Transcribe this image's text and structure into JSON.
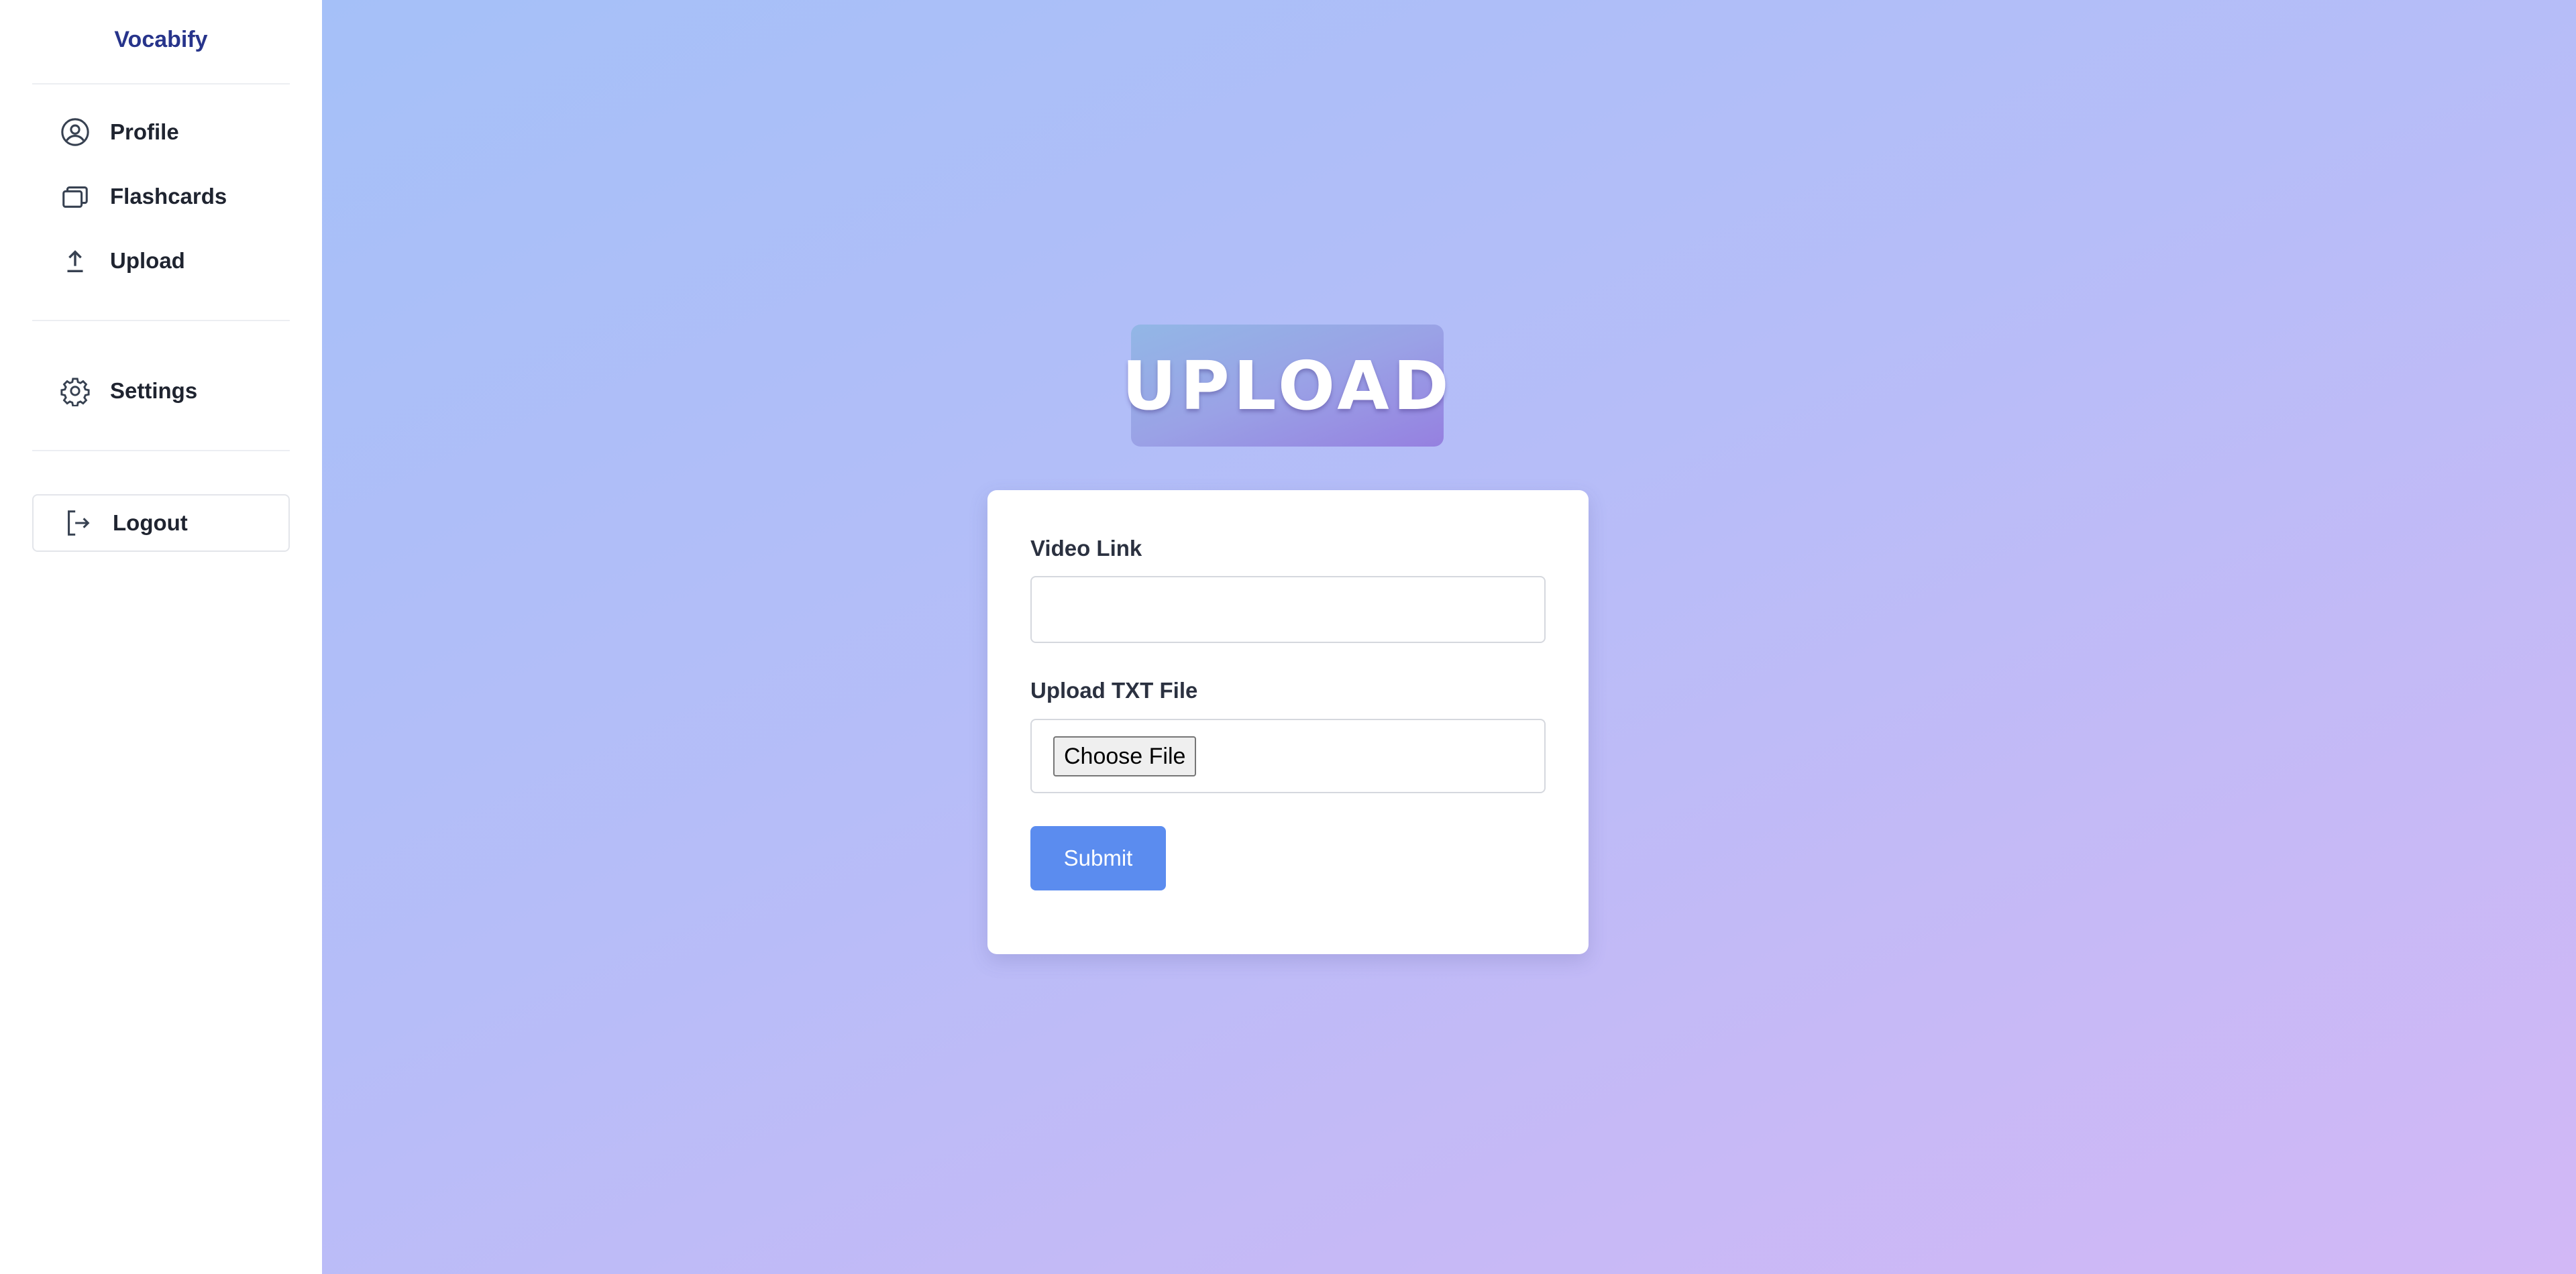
{
  "app": {
    "brand": "Vocabify"
  },
  "sidebar": {
    "items": [
      {
        "label": "Profile",
        "icon": "user-circle-icon"
      },
      {
        "label": "Flashcards",
        "icon": "cards-stack-icon"
      },
      {
        "label": "Upload",
        "icon": "upload-arrow-icon"
      },
      {
        "label": "Settings",
        "icon": "gear-icon"
      }
    ],
    "logout": {
      "label": "Logout",
      "icon": "logout-icon"
    }
  },
  "main": {
    "hero_title": "UPLOAD",
    "form": {
      "video_link_label": "Video Link",
      "video_link_value": "",
      "txt_file_label": "Upload TXT File",
      "choose_file_label": "Choose File",
      "submit_label": "Submit"
    }
  },
  "colors": {
    "brand": "#27348b",
    "submit": "#5b8cef",
    "gradient_start": "#a5c0f8",
    "gradient_end": "#d2b8f6"
  }
}
